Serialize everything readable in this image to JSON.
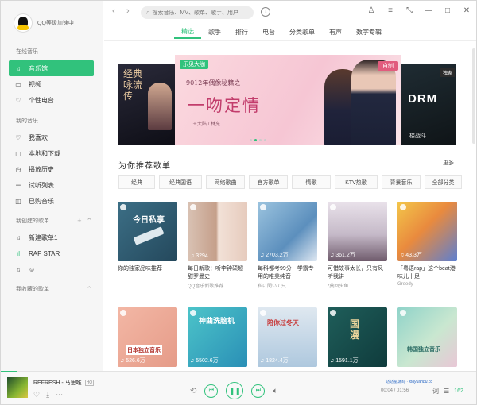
{
  "user": {
    "label": "QQ等级加速中"
  },
  "sidebar": {
    "online_head": "在线音乐",
    "online_items": [
      {
        "icon": "music-note-icon",
        "label": "音乐馆",
        "active": true
      },
      {
        "icon": "video-icon",
        "label": "视频",
        "active": false
      },
      {
        "icon": "radio-icon",
        "label": "个性电台",
        "active": false
      }
    ],
    "my_head": "我的音乐",
    "my_items": [
      {
        "icon": "heart-icon",
        "label": "我喜欢"
      },
      {
        "icon": "computer-icon",
        "label": "本地和下载"
      },
      {
        "icon": "clock-icon",
        "label": "播放历史"
      },
      {
        "icon": "audition-icon",
        "label": "试听列表"
      },
      {
        "icon": "bag-icon",
        "label": "已购音乐"
      }
    ],
    "created_head": "我创建的歌单",
    "created_items": [
      {
        "icon": "playlist-icon",
        "label": "新建歌单1"
      },
      {
        "icon": "bars-icon",
        "label": "RAP STAR"
      },
      {
        "icon": "playlist-icon",
        "label": "☺"
      }
    ],
    "collected_head": "我收藏的歌单"
  },
  "search": {
    "placeholder": "搜索音乐、MV、歌单、歌手、用户"
  },
  "tabs": [
    "精选",
    "歌手",
    "排行",
    "电台",
    "分类歌单",
    "有声",
    "数字专辑"
  ],
  "banner": {
    "left_title": "经典咏流传",
    "brand": "乐见大咖",
    "sub": "9012年偶像秘籍之",
    "title": "一吻定情",
    "cast": "王大陆 / 林允",
    "tag": "自制",
    "right_tag": "独家",
    "right_word": "DRM",
    "right_caption": "楼战斗"
  },
  "recommend": {
    "title": "为你推荐歌单",
    "more": "更多",
    "chips": [
      "经典",
      "经典国语",
      "网络歌曲",
      "官方歌单",
      "情歌",
      "KTV热歌",
      "背景音乐",
      "全部分类"
    ],
    "cards": [
      {
        "cover_text": "今日私享",
        "plays": "",
        "title": "你的独家品味推荐",
        "sub": ""
      },
      {
        "cover_text": "",
        "plays": "3294",
        "title": "每日新歌：听李钟硕超甜罗曼史",
        "sub": "QQ音乐新歌推荐"
      },
      {
        "cover_text": "",
        "plays": "2703.2万",
        "title": "每科都考99分！学霸专用的唯美纯音",
        "sub": "私に聞いて只"
      },
      {
        "cover_text": "",
        "plays": "361.2万",
        "title": "可惜故事太长，只有风听我讲",
        "sub": "*莫回头鱼"
      },
      {
        "cover_text": "",
        "plays": "43.3万",
        "title": "「粤语rap」这个beat港味儿十足",
        "sub": "Greedy"
      },
      {
        "cover_text": "日本独立音乐",
        "plays": "526.6万",
        "title": "",
        "sub": ""
      },
      {
        "cover_text": "神曲洗脑机",
        "plays": "5502.6万",
        "title": "",
        "sub": ""
      },
      {
        "cover_text": "陪你过冬天",
        "plays": "1824.4万",
        "title": "",
        "sub": ""
      },
      {
        "cover_text": "国漫",
        "plays": "1591.1万",
        "title": "",
        "sub": ""
      },
      {
        "cover_text": "韩国独立音乐",
        "plays": "",
        "title": "",
        "sub": ""
      }
    ]
  },
  "player": {
    "song": "REFRESH - 马思唯",
    "quality": "HQ",
    "time": "00:04 / 01:56",
    "watermark": "达达星源码 · louyuanbu.cc",
    "count": "162",
    "progress": 0.035
  }
}
